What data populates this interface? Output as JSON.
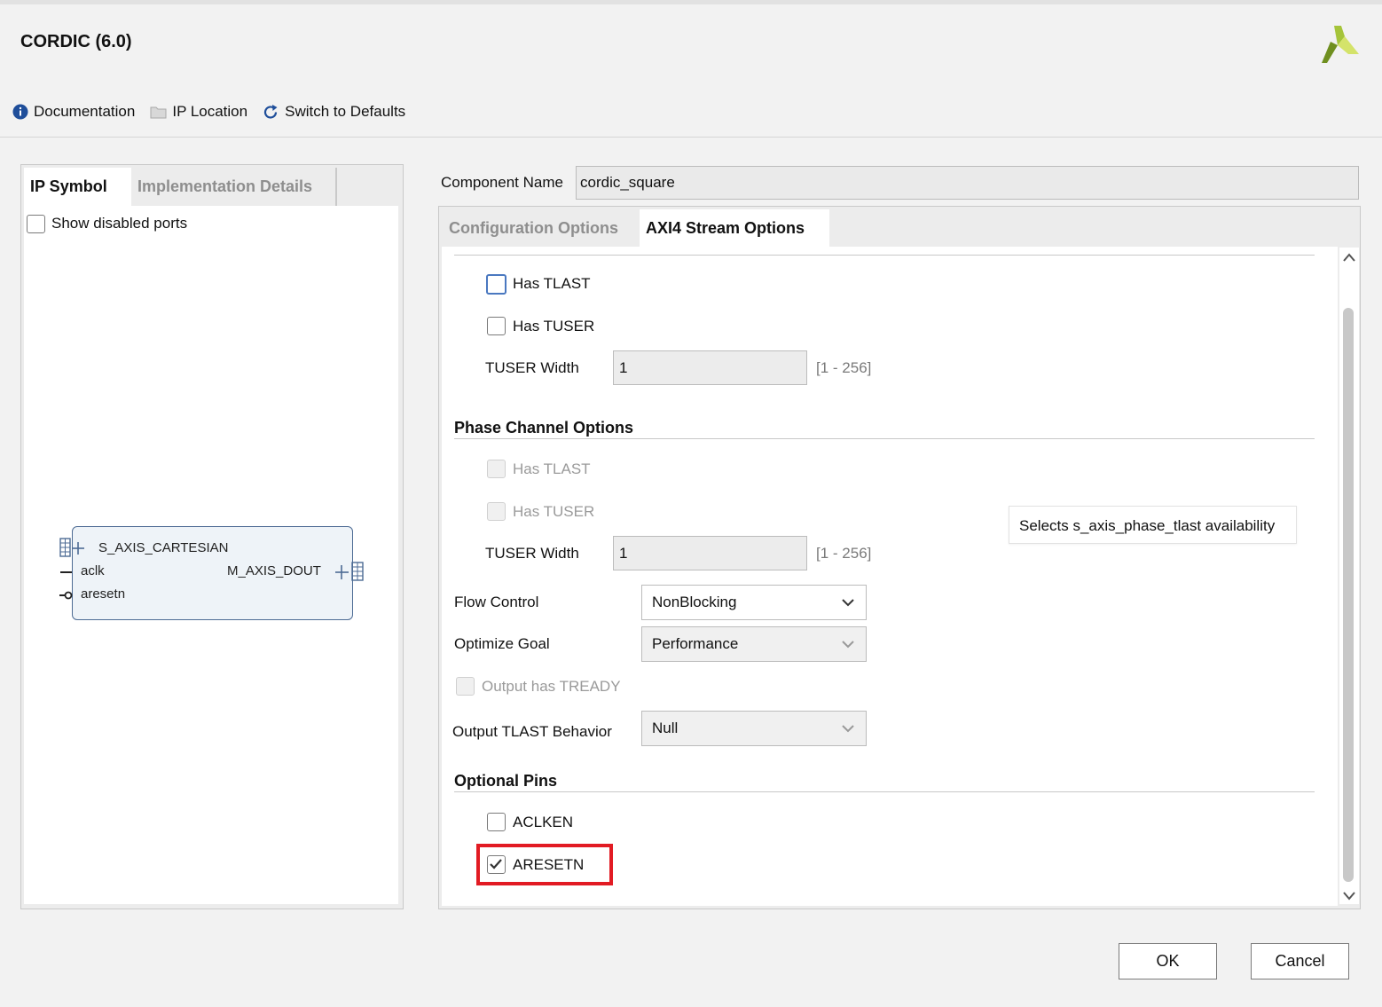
{
  "window": {
    "title": "CORDIC (6.0)"
  },
  "toolbar": {
    "documentation": "Documentation",
    "ip_location": "IP Location",
    "switch_defaults": "Switch to Defaults"
  },
  "left": {
    "tabs": [
      "IP Symbol",
      "Implementation Details"
    ],
    "show_disabled_ports": "Show disabled ports",
    "symbol": {
      "input_bus": "S_AXIS_CARTESIAN",
      "clock": "aclk",
      "reset": "aresetn",
      "output_bus": "M_AXIS_DOUT"
    }
  },
  "component": {
    "label": "Component Name",
    "value": "cordic_square"
  },
  "right_tabs": [
    "Configuration Options",
    "AXI4 Stream Options"
  ],
  "cartesian": {
    "has_tlast": "Has TLAST",
    "has_tuser": "Has TUSER",
    "tuser_width_label": "TUSER Width",
    "tuser_width_value": "1",
    "tuser_range": "[1 - 256]"
  },
  "phase": {
    "heading": "Phase Channel Options",
    "has_tlast": "Has TLAST",
    "has_tuser": "Has TUSER",
    "tuser_width_label": "TUSER Width",
    "tuser_width_value": "1",
    "tuser_range": "[1 - 256]"
  },
  "tooltip": "Selects s_axis_phase_tlast availability",
  "flow_control": {
    "label": "Flow Control",
    "value": "NonBlocking"
  },
  "optimize_goal": {
    "label": "Optimize Goal",
    "value": "Performance"
  },
  "output_tready": "Output has TREADY",
  "output_tlast": {
    "label": "Output TLAST Behavior",
    "value": "Null"
  },
  "optional_pins": {
    "heading": "Optional Pins",
    "aclken": "ACLKEN",
    "aresetn": "ARESETN"
  },
  "buttons": {
    "ok": "OK",
    "cancel": "Cancel"
  },
  "colors": {
    "highlight": "#e21b23",
    "focus": "#4a78c0",
    "logo": "#9cbc2c"
  }
}
